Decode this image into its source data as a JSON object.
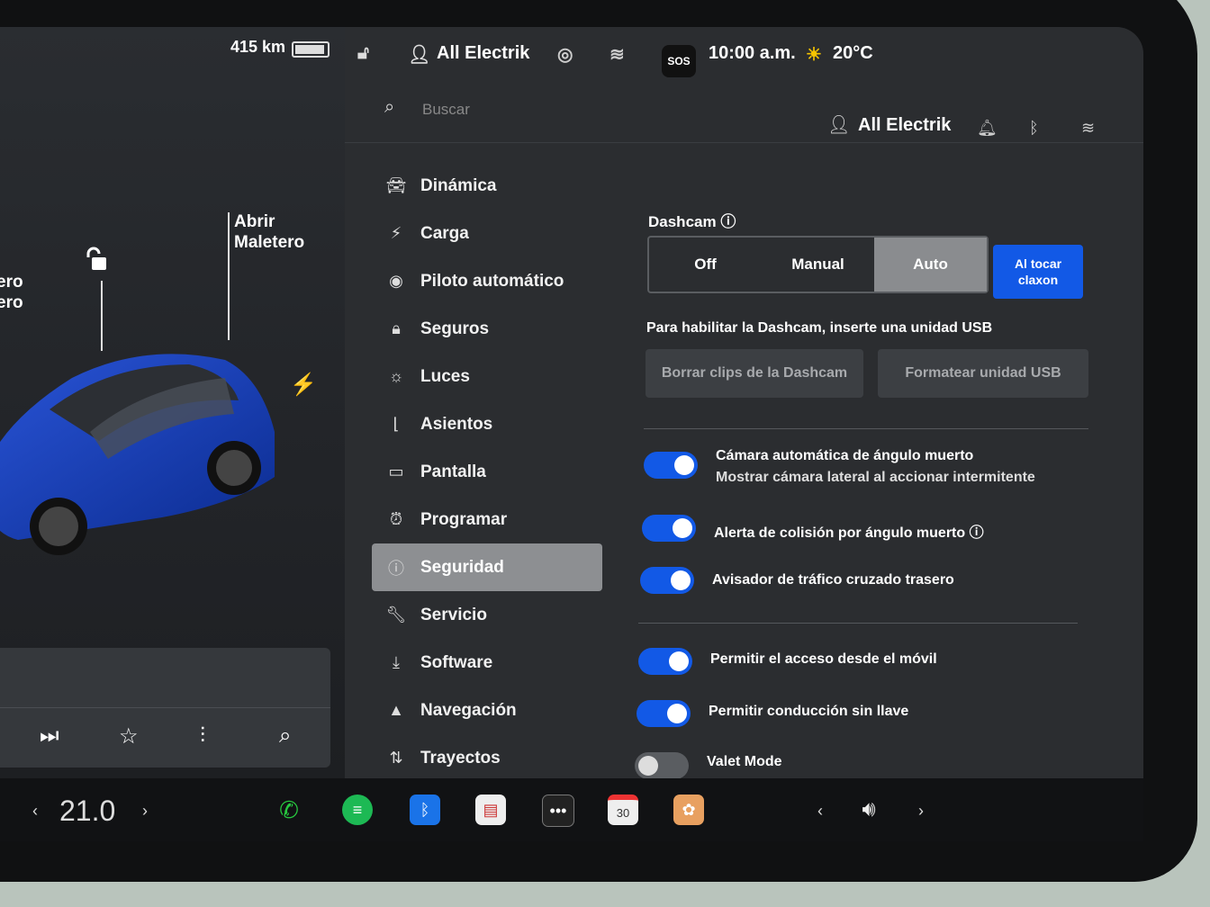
{
  "car": {
    "range": "415 km",
    "trunk_label_1": "Abrir",
    "trunk_label_2": "Maletero",
    "frunk_label_1": "ero",
    "frunk_label_2": "ero"
  },
  "status": {
    "profile": "All Electrik",
    "sos": "SOS",
    "time": "10:00 a.m.",
    "temperature": "20°C"
  },
  "search": {
    "placeholder": "Buscar"
  },
  "account": {
    "name": "All Electrik"
  },
  "menu": [
    {
      "label": "Dinámica",
      "icon": "car-icon"
    },
    {
      "label": "Carga",
      "icon": "bolt-icon"
    },
    {
      "label": "Piloto automático",
      "icon": "steering-wheel-icon"
    },
    {
      "label": "Seguros",
      "icon": "lock-icon"
    },
    {
      "label": "Luces",
      "icon": "light-icon"
    },
    {
      "label": "Asientos",
      "icon": "seat-icon"
    },
    {
      "label": "Pantalla",
      "icon": "display-icon"
    },
    {
      "label": "Programar",
      "icon": "schedule-icon"
    },
    {
      "label": "Seguridad",
      "icon": "alert-icon",
      "active": true
    },
    {
      "label": "Servicio",
      "icon": "wrench-icon"
    },
    {
      "label": "Software",
      "icon": "download-icon"
    },
    {
      "label": "Navegación",
      "icon": "navigation-icon"
    },
    {
      "label": "Trayectos",
      "icon": "trips-icon"
    }
  ],
  "dashcam": {
    "title": "Dashcam",
    "options": [
      "Off",
      "Manual",
      "Auto"
    ],
    "selected": "Auto",
    "horn_label_1": "Al tocar",
    "horn_label_2": "claxon",
    "hint": "Para habilitar la Dashcam, inserte una unidad USB",
    "delete_clips": "Borrar clips de la Dashcam",
    "format_usb": "Formatear unidad USB"
  },
  "toggles": [
    {
      "label": "Cámara automática de ángulo muerto",
      "sub": "Mostrar cámara lateral al accionar intermitente",
      "on": true
    },
    {
      "label": "Alerta de colisión por ángulo muerto",
      "on": true
    },
    {
      "label": "Avisador de tráfico cruzado trasero",
      "on": true
    },
    {
      "label": "Permitir el acceso desde el móvil",
      "on": true
    },
    {
      "label": "Permitir conducción sin llave",
      "on": true
    },
    {
      "label": "Valet Mode",
      "on": false
    }
  ],
  "dock": {
    "cabin_temp": "21.0",
    "calendar_day": "30"
  },
  "colors": {
    "accent": "#1259e6",
    "active_menu": "#8d8f92"
  }
}
